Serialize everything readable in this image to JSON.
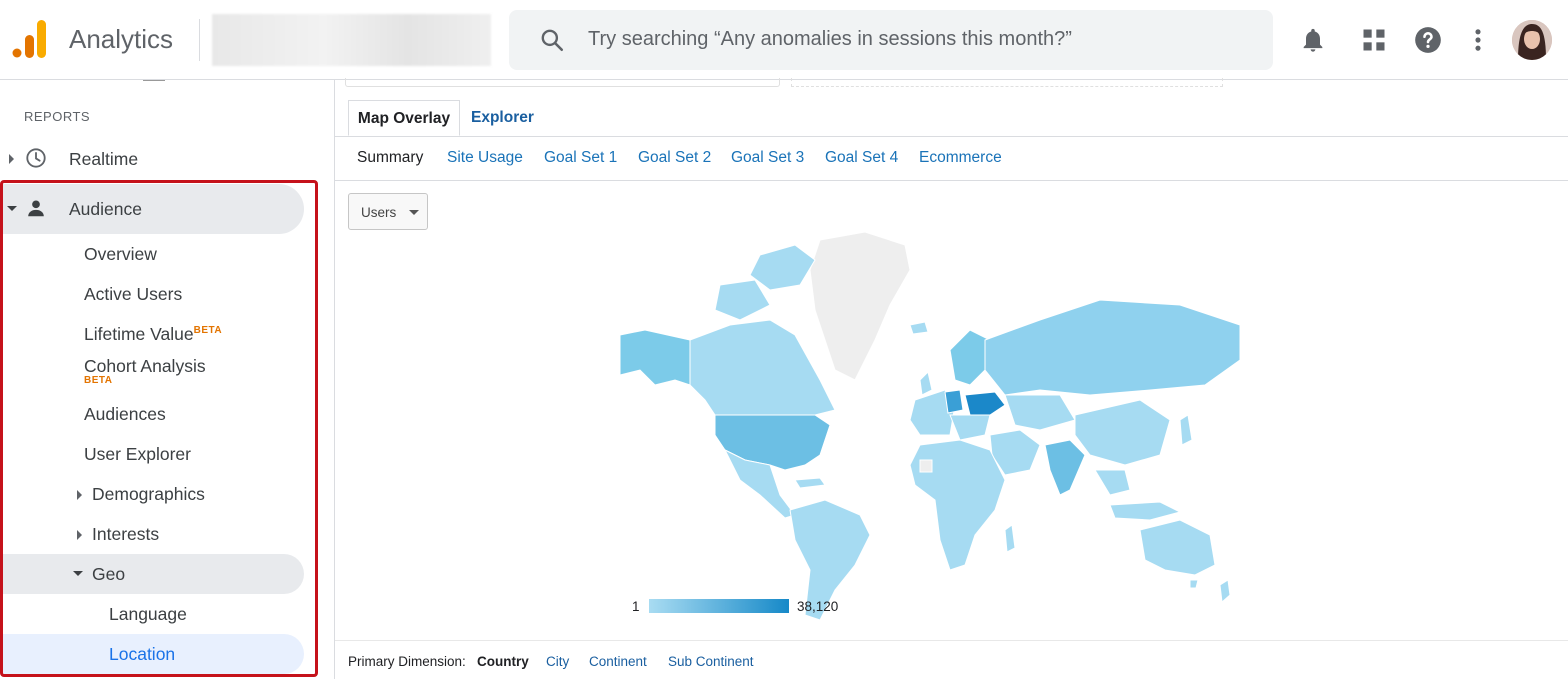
{
  "app": {
    "title": "Analytics",
    "colors": {
      "logo_orange": "#f9ab00",
      "logo_dark_orange": "#e37400"
    }
  },
  "search": {
    "placeholder": "Try searching “Any anomalies in sessions this month?”"
  },
  "top_icons": [
    "bell-icon",
    "apps-grid-icon",
    "help-icon",
    "more-vert-icon"
  ],
  "sidebar": {
    "section_label": "REPORTS",
    "realtime": "Realtime",
    "audience": "Audience",
    "items": {
      "overview": "Overview",
      "active_users": "Active Users",
      "lifetime_value": "Lifetime Value",
      "cohort_analysis": "Cohort Analysis",
      "audiences": "Audiences",
      "user_explorer": "User Explorer",
      "demographics": "Demographics",
      "interests": "Interests",
      "geo": "Geo",
      "language": "Language",
      "location": "Location"
    },
    "beta_label": "BETA",
    "highlight_color": "#c5121b"
  },
  "tabs": {
    "active": "Map Overlay",
    "other": "Explorer"
  },
  "subtabs": [
    "Summary",
    "Site Usage",
    "Goal Set 1",
    "Goal Set 2",
    "Goal Set 3",
    "Goal Set 4",
    "Ecommerce"
  ],
  "metric_select": {
    "value": "Users"
  },
  "legend": {
    "min": "1",
    "max": "38,120",
    "color_low": "#a9dcf2",
    "color_high": "#1689c8"
  },
  "primary_dimension": {
    "label": "Primary Dimension:",
    "current": "Country",
    "options": [
      "City",
      "Continent",
      "Sub Continent"
    ]
  }
}
